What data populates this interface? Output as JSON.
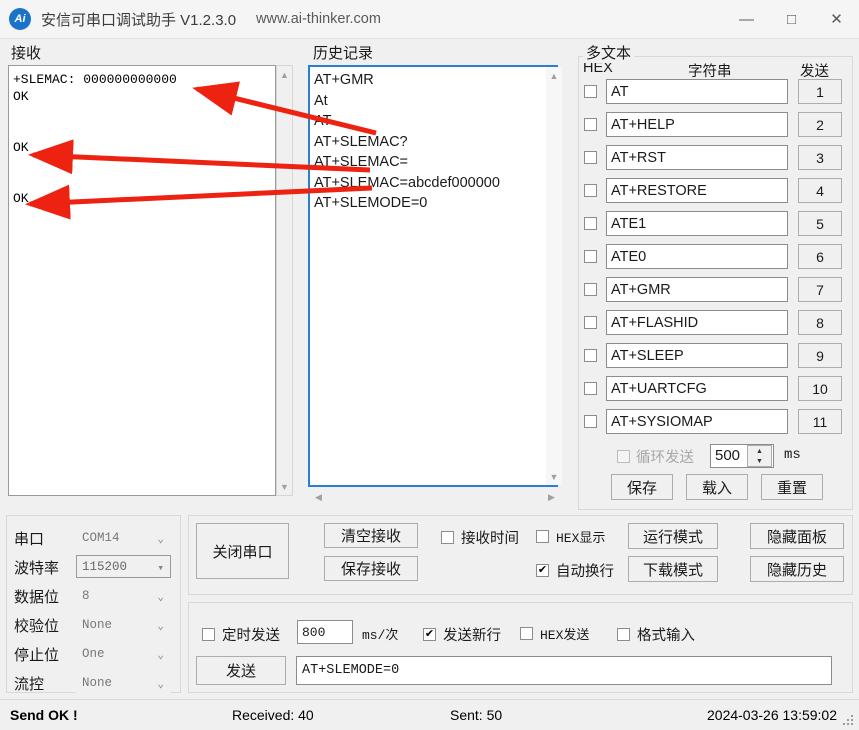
{
  "window": {
    "icon": "ai-logo-icon",
    "title": "安信可串口调试助手 V1.2.3.0",
    "url": "www.ai-thinker.com",
    "minimize": "—",
    "maximize": "□",
    "close": "✕"
  },
  "receive": {
    "label": "接收",
    "content": "+SLEMAC: 000000000000\nOK\n\n\nOK\n\n\nOK",
    "scroll_up": "▲",
    "scroll_down": "▼"
  },
  "history": {
    "label": "历史记录",
    "lines": [
      "AT+GMR",
      "At",
      "AT",
      "AT+SLEMAC?",
      "AT+SLEMAC=",
      "AT+SLEMAC=abcdef000000",
      "AT+SLEMODE=0"
    ],
    "scroll_up": "▲",
    "scroll_down": "▼",
    "scroll_left": "◀",
    "scroll_right": "▶"
  },
  "multitext": {
    "label": "多文本",
    "col_hex": "HEX",
    "col_string": "字符串",
    "col_send": "发送",
    "rows": [
      {
        "hex": false,
        "text": "AT",
        "btn": "1"
      },
      {
        "hex": false,
        "text": "AT+HELP",
        "btn": "2"
      },
      {
        "hex": false,
        "text": "AT+RST",
        "btn": "3"
      },
      {
        "hex": false,
        "text": "AT+RESTORE",
        "btn": "4"
      },
      {
        "hex": false,
        "text": "ATE1",
        "btn": "5"
      },
      {
        "hex": false,
        "text": "ATE0",
        "btn": "6"
      },
      {
        "hex": false,
        "text": "AT+GMR",
        "btn": "7"
      },
      {
        "hex": false,
        "text": "AT+FLASHID",
        "btn": "8"
      },
      {
        "hex": false,
        "text": "AT+SLEEP",
        "btn": "9"
      },
      {
        "hex": false,
        "text": "AT+UARTCFG",
        "btn": "10"
      },
      {
        "hex": false,
        "text": "AT+SYSIOMAP",
        "btn": "11"
      }
    ],
    "loop_label": "循环发送",
    "loop_checked": false,
    "loop_value": "500",
    "loop_unit": "ms",
    "spin_up": "▲",
    "spin_down": "▼",
    "save": "保存",
    "load": "载入",
    "reset": "重置"
  },
  "serial": {
    "rows": [
      {
        "label": "串口",
        "value": "COM14",
        "focused": false
      },
      {
        "label": "波特率",
        "value": "115200",
        "focused": true
      },
      {
        "label": "数据位",
        "value": "8",
        "focused": false
      },
      {
        "label": "校验位",
        "value": "None",
        "focused": false
      },
      {
        "label": "停止位",
        "value": "One",
        "focused": false
      },
      {
        "label": "流控",
        "value": "None",
        "focused": false
      }
    ],
    "chevron": "⌄"
  },
  "controls": {
    "close_port": "关闭串口",
    "clear_recv": "清空接收",
    "save_recv": "保存接收",
    "recv_time_label": "接收时间",
    "recv_time_checked": false,
    "hex_display_label": "HEX显示",
    "hex_display_checked": false,
    "auto_wrap_label": "自动换行",
    "auto_wrap_checked": true,
    "run_mode": "运行模式",
    "download_mode": "下载模式",
    "hide_panel": "隐藏面板",
    "hide_history": "隐藏历史",
    "check_mark": "✔"
  },
  "send": {
    "timed_label": "定时发送",
    "timed_checked": false,
    "timed_value": "800",
    "timed_unit": "ms/次",
    "newline_label": "发送新行",
    "newline_checked": true,
    "hex_send_label": "HEX发送",
    "hex_send_checked": false,
    "format_input_label": "格式输入",
    "format_input_checked": false,
    "send_button": "发送",
    "input_value": "AT+SLEMODE=0"
  },
  "status": {
    "send_state": "Send OK !",
    "received": "Received: 40",
    "sent": "Sent: 50",
    "datetime": "2024-03-26 13:59:02"
  },
  "annotations": {
    "arrow_color": "#ee2211",
    "count": 3
  }
}
